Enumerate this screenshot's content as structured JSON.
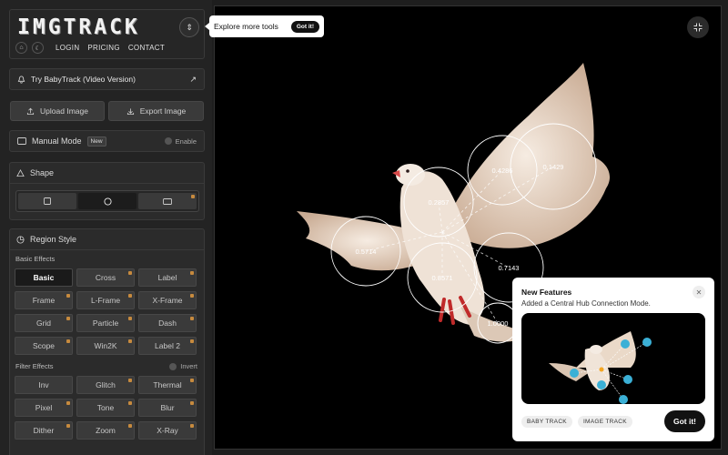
{
  "app": {
    "logo": "IMGTRACK",
    "nav": [
      "LOGIN",
      "PRICING",
      "CONTACT"
    ]
  },
  "tooltip": {
    "text": "Explore more tools",
    "button": "Got it!"
  },
  "promo": {
    "label": "Try BabyTrack (Video Version)"
  },
  "actions": {
    "upload": "Upload Image",
    "export": "Export Image"
  },
  "manual": {
    "label": "Manual Mode",
    "badge": "New",
    "toggle": "Enable"
  },
  "shape": {
    "title": "Shape",
    "options": [
      "square",
      "circle",
      "rectangle"
    ],
    "selected": "circle"
  },
  "region": {
    "title": "Region Style",
    "basic_label": "Basic Effects",
    "basic": [
      "Basic",
      "Cross",
      "Label",
      "Frame",
      "L-Frame",
      "X-Frame",
      "Grid",
      "Particle",
      "Dash",
      "Scope",
      "Win2K",
      "Label 2"
    ],
    "filter_label": "Filter Effects",
    "invert": "Invert",
    "filter": [
      "Inv",
      "Glitch",
      "Thermal",
      "Pixel",
      "Tone",
      "Blur",
      "Dither",
      "Zoom",
      "X-Ray"
    ]
  },
  "tracking": {
    "values": [
      "0.4286",
      "0.1429",
      "0.2857",
      "0.5714",
      "0.7143",
      "0.8571",
      "1.0000"
    ]
  },
  "popup": {
    "title": "New Features",
    "desc": "Added a Central Hub Connection Mode.",
    "tags": [
      "BABY TRACK",
      "IMAGE TRACK"
    ],
    "button": "Got it!"
  },
  "colors": {
    "accent_dot": "#c68a3e",
    "canvas_bg": "#000000"
  }
}
